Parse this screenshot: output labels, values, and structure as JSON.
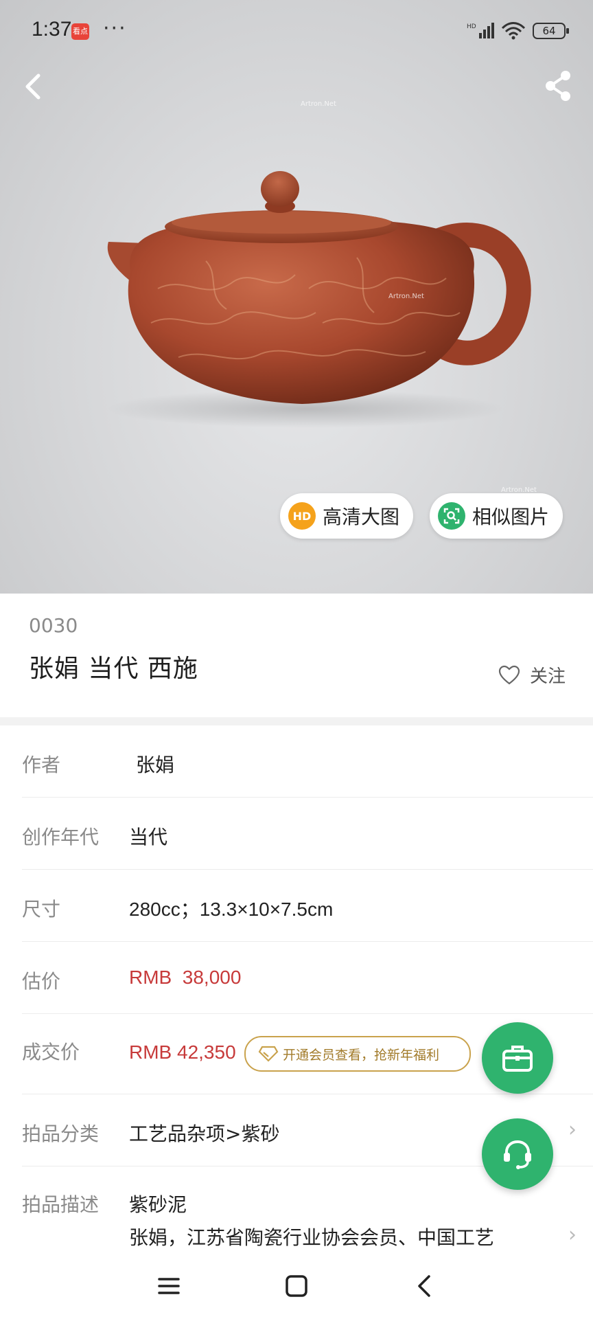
{
  "status_bar": {
    "time": "1:37",
    "app_badge": "看点",
    "more": "···",
    "battery": "64"
  },
  "hero": {
    "watermark": "Artron.Net",
    "hd_button": {
      "icon_text": "HD",
      "label": "高清大图"
    },
    "similar_button": {
      "label": "相似图片"
    }
  },
  "item": {
    "lot_number": "0030",
    "title": "张娟 当代 西施",
    "follow_label": "关注"
  },
  "details": {
    "author": {
      "label": "作者",
      "value": "张娟"
    },
    "era": {
      "label": "创作年代",
      "value": "当代"
    },
    "size": {
      "label": "尺寸",
      "value": "280cc；13.3×10×7.5cm"
    },
    "estimate": {
      "label": "估价",
      "value": "RMB  38,000"
    },
    "deal_price": {
      "label": "成交价",
      "value": "RMB 42,350",
      "vip_text": "开通会员查看，抢新年福利"
    },
    "category": {
      "label": "拍品分类",
      "value": "工艺品杂项>紫砂"
    },
    "description": {
      "label": "拍品描述",
      "line1": "紫砂泥",
      "line2": "张娟，江苏省陶瓷行业协会会员、中国工艺"
    }
  },
  "colors": {
    "accent_green": "#2fb36e",
    "price_red": "#c73a3a",
    "vip_gold": "#c9a24c",
    "hd_orange": "#f5a21b"
  }
}
